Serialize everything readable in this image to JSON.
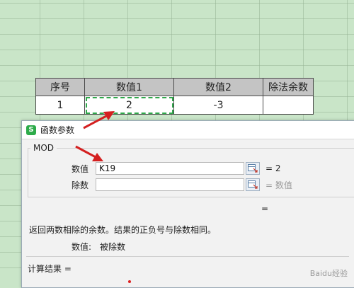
{
  "sheet": {
    "headers": [
      "序号",
      "数值1",
      "数值2",
      "除法余数"
    ],
    "row": [
      "1",
      "2",
      "-3",
      ""
    ]
  },
  "dialog": {
    "title": "函数参数",
    "function_name": "MOD",
    "args": [
      {
        "label": "数值",
        "value": "K19",
        "result": "= 2"
      },
      {
        "label": "除数",
        "value": "",
        "result": "= 数值"
      }
    ],
    "overall_equals": "=",
    "description": "返回两数相除的余数。结果的正负号与除数相同。",
    "param_name": "数值:",
    "param_desc": "被除数",
    "calc_result": "计算结果 ="
  },
  "watermark": "Baidu经验",
  "colors": {
    "sheet_bg": "#c9e5c8",
    "accent": "#2dab4a",
    "arrow": "#d42020"
  }
}
